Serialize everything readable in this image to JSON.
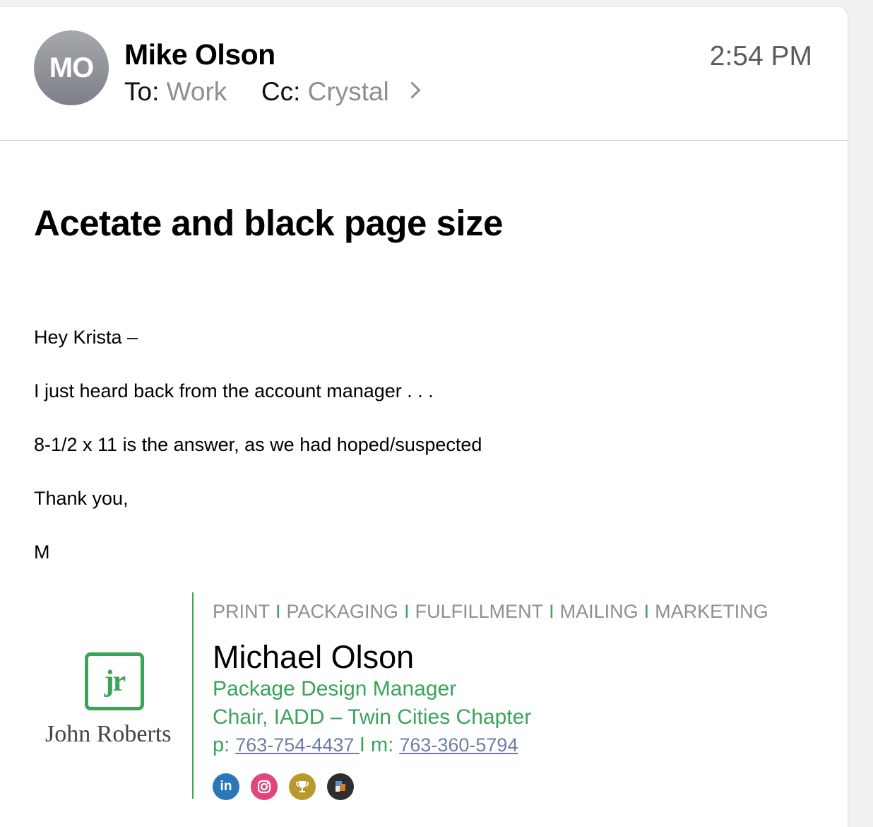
{
  "header": {
    "avatar_initials": "MO",
    "sender": "Mike Olson",
    "to_label": "To:",
    "to_value": "Work",
    "cc_label": "Cc:",
    "cc_value": "Crystal",
    "time": "2:54 PM"
  },
  "subject": "Acetate and black page size",
  "body": [
    "Hey Krista –",
    "I just heard back from the account manager . . .",
    "8-1/2 x 11 is the answer, as we had hoped/suspected",
    "Thank you,",
    "M"
  ],
  "signature": {
    "logo_mark": "jr",
    "logo_name": "John Roberts",
    "services": [
      "PRINT",
      "PACKAGING",
      "FULFILLMENT",
      "MAILING",
      "MARKETING"
    ],
    "separator": "I",
    "name": "Michael Olson",
    "title": "Package Design Manager",
    "chair": "Chair, IADD – Twin Cities Chapter",
    "phone_label": "p:",
    "phone": "763-754-4437 ",
    "mobile_sep": "I",
    "mobile_label": "m:",
    "mobile": "763-360-5794",
    "social_icons": [
      "linkedin-icon",
      "instagram-icon",
      "trophy-icon",
      "package-icon"
    ]
  },
  "colors": {
    "accent_green": "#3ba35a",
    "link": "#6b7ea8",
    "muted": "#8e8e93"
  }
}
